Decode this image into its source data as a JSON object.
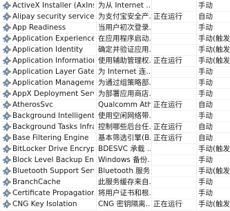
{
  "services": [
    {
      "name": "ActiveX Installer (AxInstSV)",
      "description": "为从 Internet ...",
      "status": "",
      "startup": "手动"
    },
    {
      "name": "Alipay security service",
      "description": "为支付宝安全产...",
      "status": "正在运行",
      "startup": "自动"
    },
    {
      "name": "App Readiness",
      "description": "当用户初次登录...",
      "status": "",
      "startup": "手动"
    },
    {
      "name": "Application Experience",
      "description": "在应用程序启动...",
      "status": "",
      "startup": "手动(触发"
    },
    {
      "name": "Application Identity",
      "description": "确定并验证应用...",
      "status": "",
      "startup": "手动(触发"
    },
    {
      "name": "Application Information",
      "description": "使用辅助管理权...",
      "status": "正在运行",
      "startup": "手动(触发"
    },
    {
      "name": "Application Layer Gatewa...",
      "description": "为 Internet 连...",
      "status": "",
      "startup": "手动"
    },
    {
      "name": "Application Management",
      "description": "为通过组策略部...",
      "status": "",
      "startup": "手动"
    },
    {
      "name": "AppX Deployment Servic...",
      "description": "为部署应用商店...",
      "status": "",
      "startup": "手动"
    },
    {
      "name": "AtherosSvc",
      "description": "Qualcomm Ath...",
      "status": "正在运行",
      "startup": "自动"
    },
    {
      "name": "Background Intelligent T...",
      "description": "使用空闲网络带...",
      "status": "",
      "startup": "手动"
    },
    {
      "name": "Background Tasks Infras...",
      "description": "控制哪些后台任...",
      "status": "正在运行",
      "startup": "自动"
    },
    {
      "name": "Base Filtering Engine",
      "description": "基本筛选引擎(B...",
      "status": "正在运行",
      "startup": "自动"
    },
    {
      "name": "BitLocker Drive Encryptio...",
      "description": "BDESVC 承载 ...",
      "status": "",
      "startup": "手动(触发"
    },
    {
      "name": "Block Level Backup Engi...",
      "description": "Windows 备份...",
      "status": "",
      "startup": "手动"
    },
    {
      "name": "Bluetooth Support Service",
      "description": "Bluetooth 服务...",
      "status": "",
      "startup": "手动(触发"
    },
    {
      "name": "BranchCache",
      "description": "此服务缓存来自...",
      "status": "",
      "startup": "手动"
    },
    {
      "name": "Certificate Propagation",
      "description": "将用户证书和根...",
      "status": "",
      "startup": "手动"
    },
    {
      "name": "CNG Key Isolation",
      "description": "CNG 密钥隔离...",
      "status": "正在运行",
      "startup": "手动(触发"
    }
  ]
}
